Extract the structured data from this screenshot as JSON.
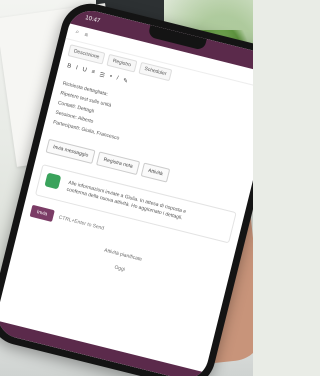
{
  "status_bar": {
    "time": "10:47"
  },
  "app": {
    "tabs": [
      {
        "label": "Descrizione"
      },
      {
        "label": "Registro"
      },
      {
        "label": "Scheduler"
      }
    ],
    "format_toolbar": [
      "B",
      "I",
      "U",
      "≡",
      "☰",
      "•",
      "/",
      "✎"
    ],
    "body_lines": [
      "Richiesta dettagliata:",
      "Ripetere test sulle unità",
      "Contatti: Dettagli",
      "Sessione: Alberto",
      "Partecipanti: Giulia, Francesco"
    ],
    "buttons": [
      {
        "label": "Invia messaggio"
      },
      {
        "label": "Registra nota"
      },
      {
        "label": "Attività"
      }
    ],
    "message_card_text": "Alle informazioni inviate a Giulia. In attesa di risposta e conferma della nuova attività. Ho aggiornato i dettagli.",
    "send_row": {
      "send_label": "Invia",
      "hint": "CTRL+Enter to Send"
    },
    "section_separator": "Attività pianificate",
    "footer_label": "Oggi"
  }
}
